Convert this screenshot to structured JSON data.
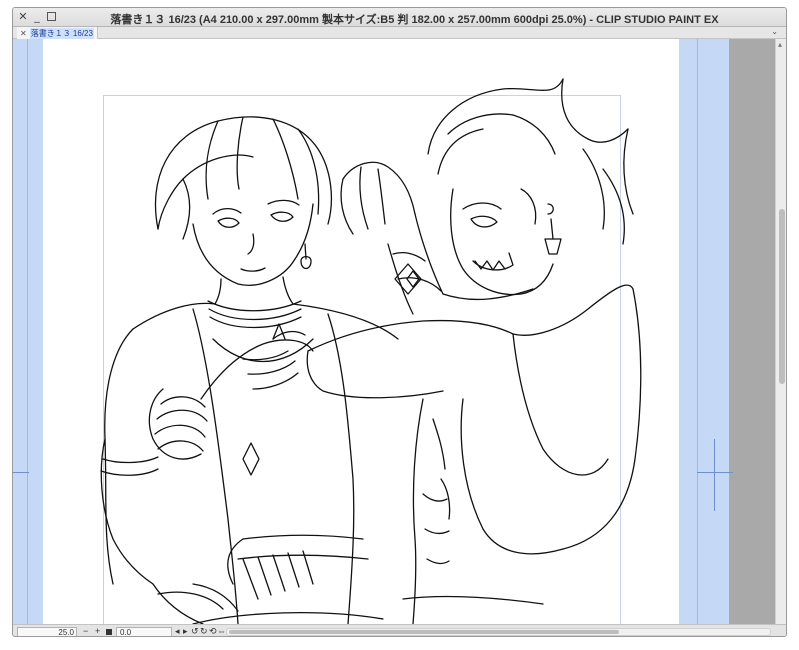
{
  "window": {
    "title": "落書き１３ 16/23 (A4 210.00 x 297.00mm 製本サイズ:B5 判 182.00 x 257.00mm 600dpi 25.0%)  - CLIP STUDIO PAINT EX",
    "close_glyph": "✕",
    "min_glyph": "_"
  },
  "tab": {
    "close_glyph": "✕",
    "label": "落書き１３ 16/23",
    "menu_glyph": "⌄"
  },
  "statusbar": {
    "zoom": "25.0",
    "zoom_out": "−",
    "zoom_in": "+",
    "angle": "0.0",
    "buttons": [
      "◂",
      "▸",
      "↺",
      "↻",
      "⟲",
      "⇔"
    ]
  },
  "scroll": {
    "up_glyph": "▴"
  },
  "colors": {
    "margin_blue": "#c5d9f6",
    "guide_blue": "#6f8fcc",
    "outside_gray": "#a9a9a9",
    "line_art": "#111111"
  }
}
